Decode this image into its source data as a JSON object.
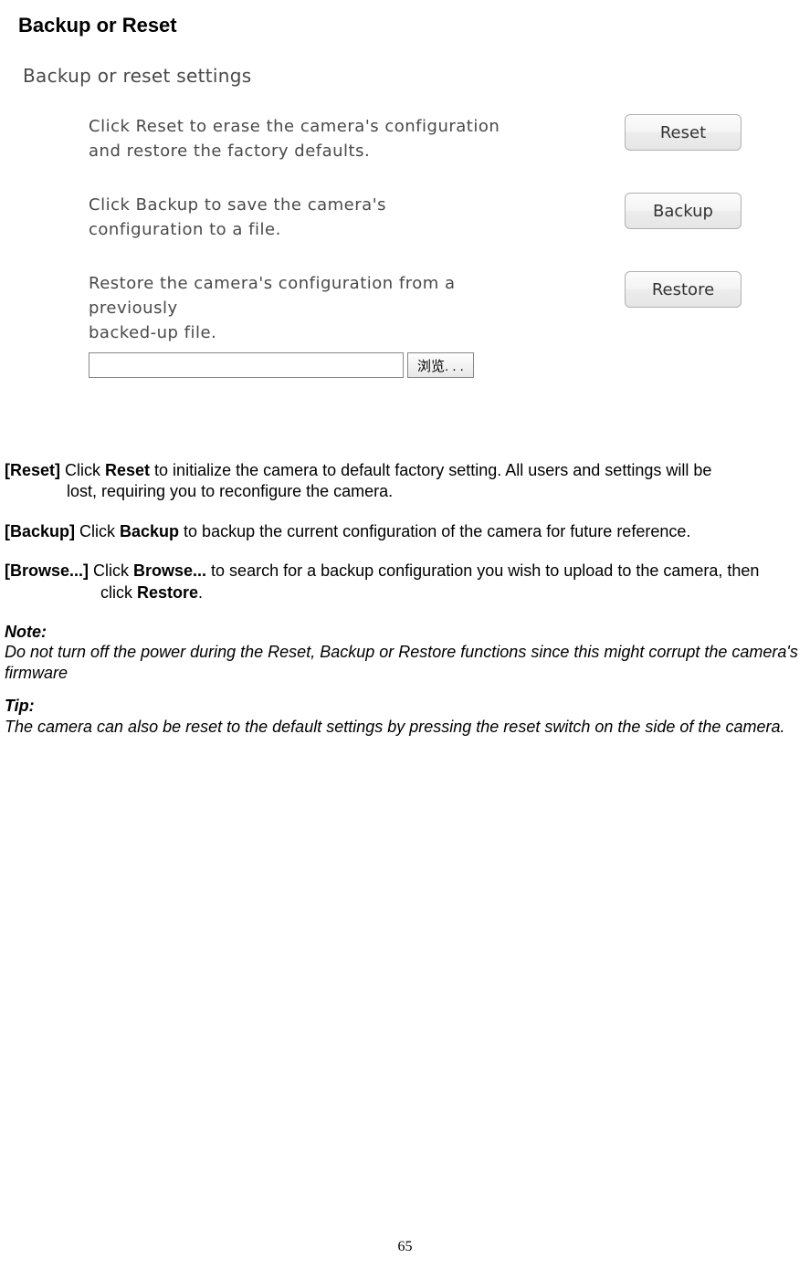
{
  "heading": "Backup or Reset",
  "panel": {
    "title": "Backup or reset settings",
    "reset_text_l1": "Click Reset to erase the camera's configuration",
    "reset_text_l2": "and restore the factory defaults.",
    "reset_btn": "Reset",
    "backup_text_l1": "Click Backup to save the camera's",
    "backup_text_l2": "configuration to a file.",
    "backup_btn": "Backup",
    "restore_text_l1": "Restore the camera's configuration from a previously",
    "restore_text_l2": "backed-up file.",
    "restore_btn": "Restore",
    "file_input_value": "",
    "browse_btn": "浏览. . ."
  },
  "descriptions": {
    "reset_label": "[Reset] ",
    "reset_click": "Click ",
    "reset_bold": "Reset",
    "reset_rest1": " to initialize the camera to default factory setting. All users and settings will be",
    "reset_rest2": "lost, requiring you to reconfigure the camera.",
    "backup_label": "[Backup] ",
    "backup_click": "Click ",
    "backup_bold": "Backup",
    "backup_rest": " to backup the current configuration of the camera for future reference.",
    "browse_label": "[Browse...] ",
    "browse_click": "Click ",
    "browse_bold": "Browse...",
    "browse_rest1": " to search for a backup configuration you wish to upload to the camera, then",
    "browse_rest2_a": "click ",
    "browse_rest2_b": "Restore",
    "browse_rest2_c": "."
  },
  "note": {
    "title": "Note:",
    "text": "Do not turn off the power during the Reset, Backup or Restore functions since this might corrupt the camera's firmware"
  },
  "tip": {
    "title": "Tip:",
    "text": "The camera can also be reset to the default settings by pressing the reset switch on the side of the camera."
  },
  "page_number": "65"
}
